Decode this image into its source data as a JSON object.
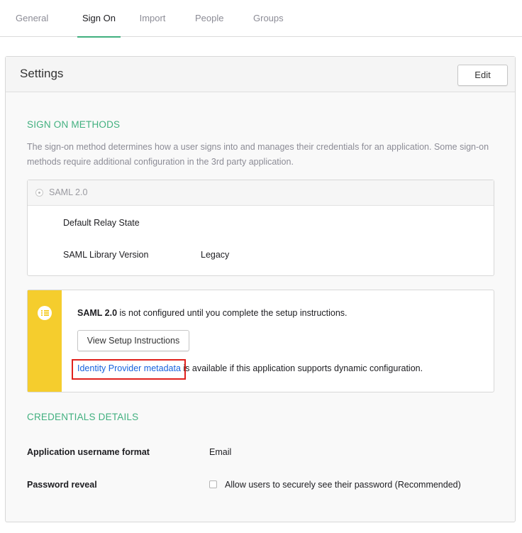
{
  "tabs": [
    {
      "label": "General"
    },
    {
      "label": "Sign On"
    },
    {
      "label": "Import"
    },
    {
      "label": "People"
    },
    {
      "label": "Groups"
    }
  ],
  "active_tab": "Sign On",
  "settings": {
    "title": "Settings",
    "edit_label": "Edit"
  },
  "sign_on_methods": {
    "title": "SIGN ON METHODS",
    "description": "The sign-on method determines how a user signs into and manages their credentials for an application. Some sign-on methods require additional configuration in the 3rd party application.",
    "method_label": "SAML 2.0",
    "fields": [
      {
        "label": "Default Relay State",
        "value": ""
      },
      {
        "label": "SAML Library Version",
        "value": "Legacy"
      }
    ]
  },
  "notice": {
    "strong": "SAML 2.0",
    "text": " is not configured until you complete the setup instructions.",
    "button_label": "View Setup Instructions",
    "link_label": "Identity Provider metadata",
    "link_suffix": " is available if this application supports dynamic configuration."
  },
  "credentials": {
    "title": "CREDENTIALS DETAILS",
    "username_format_label": "Application username format",
    "username_format_value": "Email",
    "password_reveal_label": "Password reveal",
    "password_reveal_option": "Allow users to securely see their password (Recommended)",
    "password_reveal_checked": false
  },
  "colors": {
    "accent": "#41b07f",
    "notice": "#f5cd2d",
    "link": "#1662dd",
    "highlight": "#e0211d"
  }
}
